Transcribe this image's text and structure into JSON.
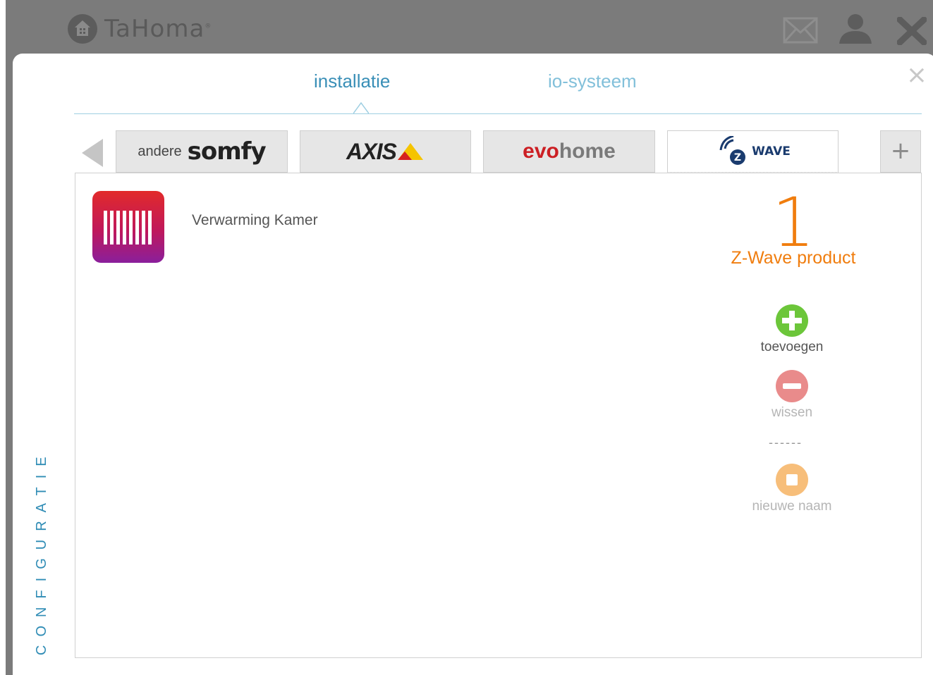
{
  "app": {
    "name": "TaHoma",
    "trademark": "®"
  },
  "icons": {
    "mail": "mail-icon",
    "user": "user-icon",
    "close": "close-icon"
  },
  "top_tabs": [
    {
      "label": "installatie",
      "active": true
    },
    {
      "label": "io-systeem",
      "active": false
    }
  ],
  "brand_tabs": {
    "somfy": {
      "prefix": "andere",
      "name": "somfy"
    },
    "axis": {
      "name": "AXIS"
    },
    "evohome": {
      "part1": "evo",
      "part2": "home"
    },
    "zwave": {
      "name": "WAVE",
      "selected": true
    },
    "add_label": "+"
  },
  "device": {
    "name": "Verwarming Kamer",
    "icon": "radiator-icon"
  },
  "summary": {
    "count": "1",
    "label": "Z-Wave product"
  },
  "actions": {
    "add": "toevoegen",
    "delete": "wissen",
    "separator": "------",
    "rename": "nieuwe naam"
  },
  "sidebar_label": "CONFIGURATIE",
  "colors": {
    "accent_blue": "#3a8fb7",
    "orange": "#f07d0e",
    "green": "#6cc63a",
    "red": "#e98b8b",
    "orange_light": "#f7be7a"
  }
}
